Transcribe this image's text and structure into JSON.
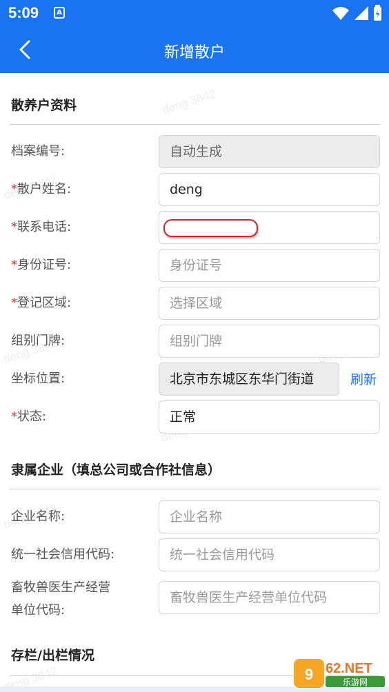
{
  "status_bar": {
    "time": "5:09",
    "notification_icon": "A",
    "icons": [
      "wifi-icon",
      "signal-icon",
      "battery-icon"
    ]
  },
  "nav": {
    "title": "新增散户",
    "back_icon": "chevron-left-icon"
  },
  "section1": {
    "title": "散养户资料"
  },
  "fields": [
    {
      "label": "档案编号:",
      "required": false,
      "value": "自动生成",
      "placeholder": ""
    },
    {
      "label": "散户姓名:",
      "required": true,
      "value": "deng",
      "placeholder": ""
    },
    {
      "label": "联系电话:",
      "required": true,
      "value": "",
      "placeholder": ""
    },
    {
      "label": "身份证号:",
      "required": true,
      "value": "",
      "placeholder": "身份证号"
    },
    {
      "label": "登记区域:",
      "required": true,
      "value": "",
      "placeholder": "选择区域"
    },
    {
      "label": "组别门牌:",
      "required": false,
      "value": "",
      "placeholder": "组别门牌"
    },
    {
      "label": "坐标位置:",
      "required": false,
      "value": "北京市东城区东华门街道",
      "placeholder": ""
    },
    {
      "label": "状态:",
      "required": true,
      "value": "正常",
      "placeholder": ""
    }
  ],
  "refresh_label": "刷新",
  "section2": {
    "title": "隶属企业（填总公司或合作社信息）"
  },
  "company_fields": [
    {
      "label": "企业名称:",
      "placeholder": "企业名称"
    },
    {
      "label": "统一社会信用代码:",
      "placeholder": "统一社会信用代码"
    },
    {
      "label_line1": "畜牧兽医生产经营",
      "label_line2": "单位代码:",
      "placeholder": "畜牧兽医生产经营单位代码"
    }
  ],
  "section3": {
    "title": "存栏/出栏情况"
  },
  "required_mark": "*",
  "watermark": "deng 3842",
  "logo": {
    "text": "962.NET",
    "sub": "乐游网"
  },
  "colors": {
    "primary": "#1a73f0",
    "required": "#e03030",
    "redaction": "#c62828"
  }
}
